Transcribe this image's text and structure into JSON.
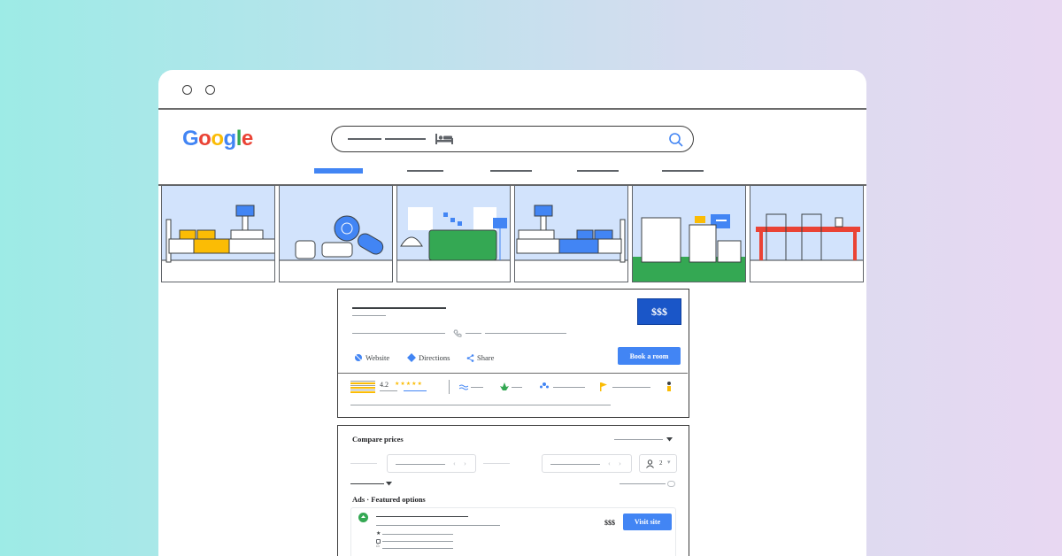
{
  "logo": {
    "letters": [
      "G",
      "o",
      "o",
      "g",
      "l",
      "e"
    ],
    "colors": [
      "#4285f4",
      "#ea4335",
      "#fbbc05",
      "#4285f4",
      "#34a853",
      "#ea4335"
    ]
  },
  "search": {
    "icon": "bed-icon",
    "action_icon": "search-icon"
  },
  "hotel": {
    "price_badge": "$$$",
    "actions": {
      "website": "Website",
      "directions": "Directions",
      "share": "Share"
    },
    "book_button": "Book a room",
    "rating": "4.2",
    "stars": "★★★★★"
  },
  "compare": {
    "title": "Compare prices",
    "guests": "2",
    "ads_heading": "Ads · Featured options",
    "ad_price": "$$$",
    "visit_button": "Visit site"
  },
  "colors": {
    "accent": "#4285f4",
    "badge": "#1a56c8",
    "sky": "#d2e3fc"
  }
}
